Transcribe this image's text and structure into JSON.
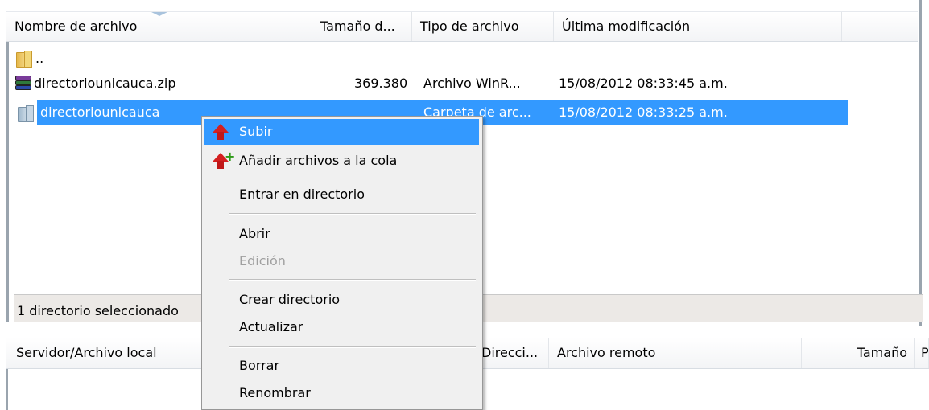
{
  "file_list": {
    "columns": [
      "Nombre de archivo",
      "Tamaño d...",
      "Tipo de archivo",
      "Última modificación"
    ],
    "rows": [
      {
        "name": "..",
        "size": "",
        "type": "",
        "modified": "",
        "icon": "folder-icon"
      },
      {
        "name": "directoriounicauca.zip",
        "size": "369.380",
        "type": "Archivo WinR...",
        "modified": "15/08/2012 08:33:45 a.m.",
        "icon": "winrar-archive-icon"
      },
      {
        "name": "directoriounicauca",
        "size": "",
        "type": "Carpeta de arc...",
        "modified": "15/08/2012 08:33:25 a.m.",
        "icon": "folder-icon"
      }
    ],
    "status": "1 directorio seleccionado"
  },
  "queue": {
    "columns": [
      "Servidor/Archivo local",
      "Direcci...",
      "Archivo remoto",
      "Tamaño",
      "P"
    ]
  },
  "context_menu": {
    "items": [
      {
        "label": "Subir",
        "icon": "upload-arrow-icon",
        "highlighted": true
      },
      {
        "label": "Añadir archivos a la cola",
        "icon": "add-to-queue-icon"
      },
      {
        "label": "Entrar en directorio"
      },
      {
        "label": "Abrir"
      },
      {
        "label": "Edición",
        "disabled": true
      },
      {
        "label": "Crear directorio"
      },
      {
        "label": "Actualizar"
      },
      {
        "label": "Borrar"
      },
      {
        "label": "Renombrar"
      }
    ]
  },
  "colors": {
    "selection": "#3399ff",
    "menu_background": "#f0f0f0",
    "status_bar": "#ece9e6"
  }
}
